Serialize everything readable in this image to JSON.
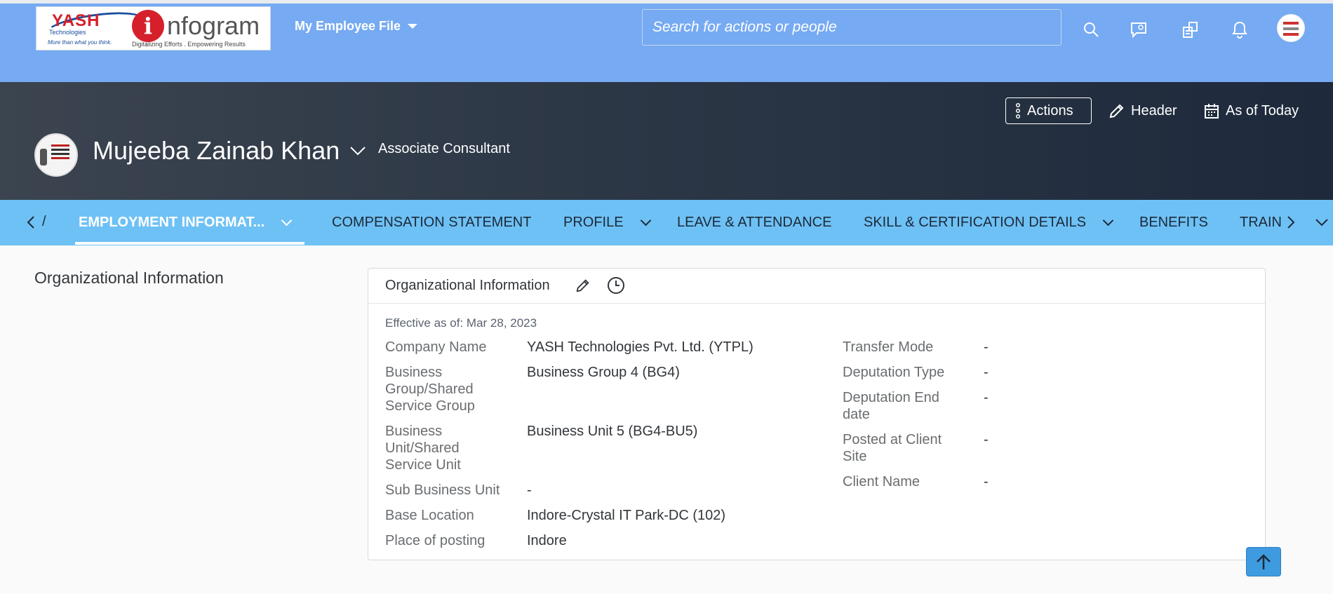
{
  "shell": {
    "logo": {
      "yash_word": "YASH",
      "yash_sub": "Technologies",
      "yash_tagline": "More than what you think.",
      "info_i": "i",
      "info_word": "nfogram",
      "info_tagline": "Digitalizing Efforts . Empowering Results"
    },
    "app_menu_label": "My Employee File",
    "search_placeholder": "Search for actions or people",
    "icons": [
      "search-icon",
      "chat-icon",
      "org-chart-icon",
      "bell-icon",
      "avatar"
    ]
  },
  "header": {
    "actions_label": "Actions",
    "header_label": "Header",
    "as_of_label": "As of Today",
    "employee_name": "Mujeeba Zainab Khan",
    "job_title": "Associate Consultant"
  },
  "tabs": [
    {
      "label": "EMPLOYMENT INFORMAT...",
      "active": true,
      "dropdown": true
    },
    {
      "label": "COMPENSATION STATEMENT",
      "active": false,
      "dropdown": false
    },
    {
      "label": "PROFILE",
      "active": false,
      "dropdown": true
    },
    {
      "label": "LEAVE & ATTENDANCE",
      "active": false,
      "dropdown": false
    },
    {
      "label": "SKILL & CERTIFICATION DETAILS",
      "active": false,
      "dropdown": true
    },
    {
      "label": "BENEFITS",
      "active": false,
      "dropdown": false
    },
    {
      "label": "TRAIN",
      "active": false,
      "dropdown": false
    }
  ],
  "section": {
    "title": "Organizational Information"
  },
  "card": {
    "title": "Organizational Information",
    "effective": "Effective as of: Mar 28, 2023",
    "left_fields": [
      {
        "label": "Company Name",
        "value": "YASH Technologies Pvt. Ltd. (YTPL)"
      },
      {
        "label": "Business Group/Shared Service Group",
        "value": "Business Group 4 (BG4)"
      },
      {
        "label": "Business Unit/Shared Service Unit",
        "value": "Business Unit 5 (BG4-BU5)"
      },
      {
        "label": "Sub Business Unit",
        "value": "-"
      },
      {
        "label": "Base Location",
        "value": "Indore-Crystal IT Park-DC (102)"
      },
      {
        "label": "Place of posting",
        "value": "Indore"
      }
    ],
    "right_fields": [
      {
        "label": "Transfer Mode",
        "value": "-"
      },
      {
        "label": "Deputation Type",
        "value": "-"
      },
      {
        "label": "Deputation End date",
        "value": "-"
      },
      {
        "label": "Posted at Client Site",
        "value": "-"
      },
      {
        "label": "Client Name",
        "value": "-"
      }
    ]
  },
  "colors": {
    "shellbar": "#76aaf2",
    "tabbar": "#6ec1f5",
    "scroll_top": "#3f9be0"
  }
}
